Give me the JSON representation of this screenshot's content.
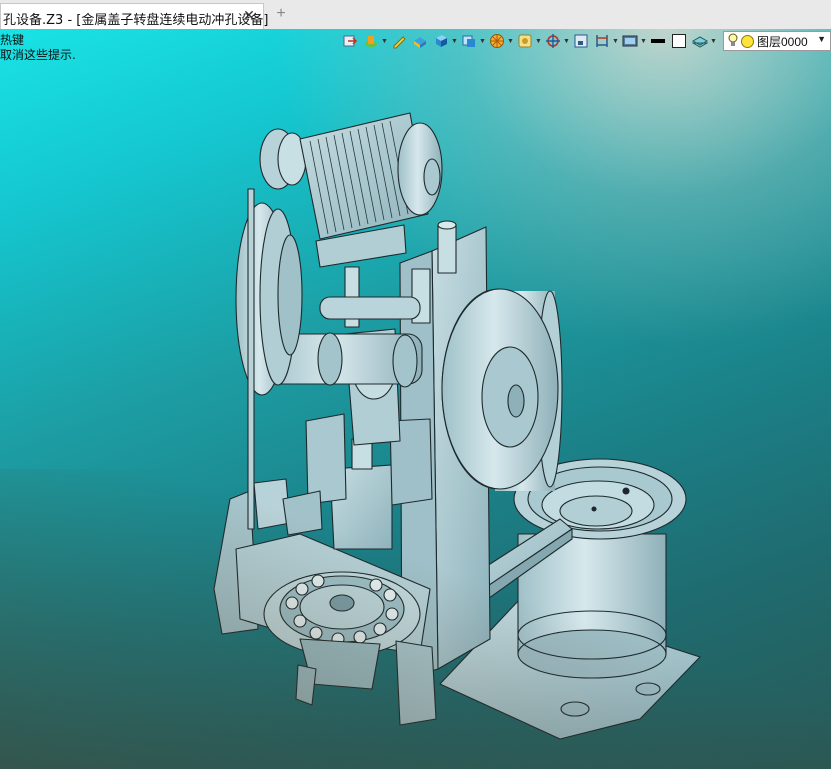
{
  "window": {
    "tab_title": "孔设备.Z3 - [金属盖子转盘连续电动冲孔设备]",
    "close_symbol": "✕",
    "new_tab_symbol": "+"
  },
  "hints": [
    "热键",
    "取消这些提示."
  ],
  "toolbar": {
    "items": [
      {
        "name": "exit-sketch-icon",
        "dropdown": false
      },
      {
        "name": "extrude-feature-icon",
        "dropdown": true
      },
      {
        "name": "edit-pen-icon",
        "dropdown": false
      },
      {
        "name": "paint-bucket-icon",
        "dropdown": false
      },
      {
        "name": "shaded-cube-icon",
        "dropdown": true
      },
      {
        "name": "display-mode-icon",
        "dropdown": true
      },
      {
        "name": "filter-wheel-icon",
        "dropdown": true
      },
      {
        "name": "snap-icon",
        "dropdown": true
      },
      {
        "name": "rotate-view-icon",
        "dropdown": true
      },
      {
        "name": "zoom-area-icon",
        "dropdown": false
      },
      {
        "name": "dimension-icon",
        "dropdown": true
      },
      {
        "name": "render-settings-icon",
        "dropdown": true
      },
      {
        "name": "line-color-swatch-icon",
        "dropdown": false
      },
      {
        "name": "fill-swatch-icon",
        "dropdown": false
      },
      {
        "name": "layer-manager-icon",
        "dropdown": true
      }
    ],
    "colors": {
      "line_color": "#000000",
      "fill_color": "#ffffff"
    },
    "layer": {
      "label": "图层0000",
      "state_icon": "light-bulb-icon"
    }
  },
  "viewport": {
    "background_top": "#19e3e6",
    "background_bottom": "#2a5a57",
    "model_color": "#a8c8cf"
  }
}
